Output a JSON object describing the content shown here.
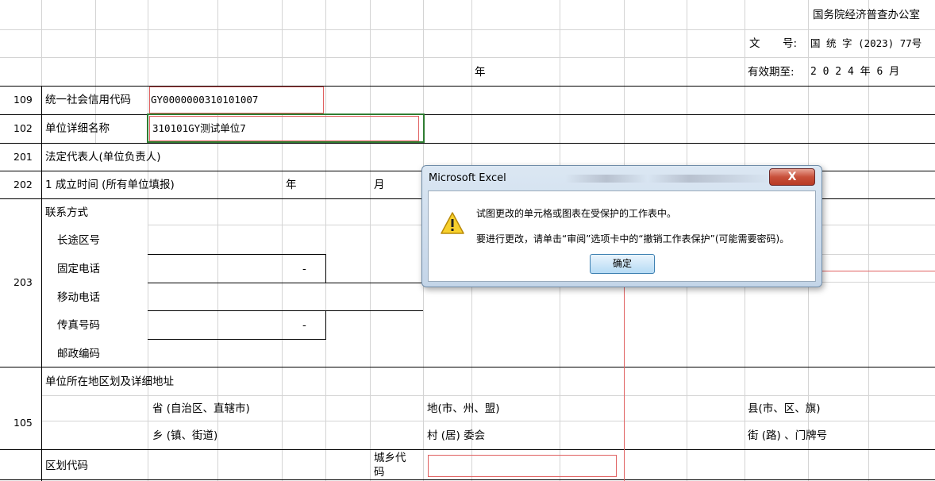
{
  "header": {
    "office": "国务院经济普查办公室",
    "doc_label_a": "文",
    "doc_label_b": "号:",
    "doc_number": "国 统 字 (2023) 77号",
    "year": "年",
    "validity_label": "有效期至:",
    "validity_value": "2 0 2 4 年 6 月"
  },
  "rows": {
    "r109": {
      "num": "109",
      "label": "统一社会信用代码",
      "value": "GY0000000310101007"
    },
    "r102": {
      "num": "102",
      "label": "单位详细名称",
      "value": "310101GY测试单位7"
    },
    "r201": {
      "num": "201",
      "label": "法定代表人(单位负责人)"
    },
    "r202": {
      "num": "202",
      "label": "1 成立时间 (所有单位填报)",
      "year": "年",
      "month": "月"
    },
    "r203": {
      "num": "203",
      "label": "联系方式",
      "long_distance": "长途区号",
      "landline": "固定电话",
      "dash1": "-",
      "mobile": "移动电话",
      "fax": "传真号码",
      "dash2": "-",
      "postal": "邮政编码"
    },
    "r105": {
      "num": "105",
      "label": "单位所在地区划及详细地址",
      "province": "省 (自治区、直辖市)",
      "city": "地(市、州、盟)",
      "county": "县(市、区、旗)",
      "township": "乡 (镇、街道)",
      "village": "村 (居) 委会",
      "street": "街 (路) 、门牌号"
    },
    "area": {
      "label": "区划代码",
      "urban_rural_1": "城乡代",
      "urban_rural_2": "码"
    }
  },
  "dialog": {
    "title": "Microsoft Excel",
    "close": "X",
    "icon": "warning-icon",
    "message1": "试图更改的单元格或图表在受保护的工作表中。",
    "message2": "要进行更改，请单击“审阅”选项卡中的“撤销工作表保护”(可能需要密码)。",
    "ok": "确定"
  },
  "colors": {
    "grid": "#d4d4d4",
    "invalid_border": "#e06060",
    "selection": "#2f7d32"
  }
}
